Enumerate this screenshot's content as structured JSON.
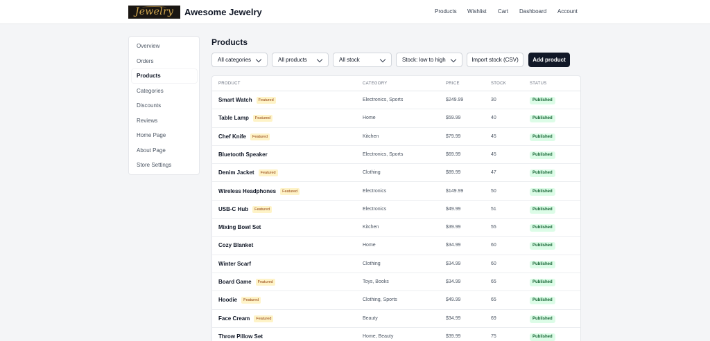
{
  "header": {
    "logo_text": "Jewelry",
    "brand": "Awesome Jewelry",
    "nav": [
      "Products",
      "Wishlist",
      "Cart",
      "Dashboard",
      "Account"
    ]
  },
  "sidebar": {
    "items": [
      {
        "label": "Overview"
      },
      {
        "label": "Orders"
      },
      {
        "label": "Products",
        "active": true
      },
      {
        "label": "Categories"
      },
      {
        "label": "Discounts"
      },
      {
        "label": "Reviews"
      },
      {
        "label": "Home Page"
      },
      {
        "label": "About Page"
      },
      {
        "label": "Store Settings"
      }
    ]
  },
  "main": {
    "title": "Products",
    "filters": {
      "category": "All categories",
      "products": "All products",
      "stock": "All stock",
      "sort": "Stock: low to high"
    },
    "import_label": "Import stock (CSV)",
    "add_label": "Add product",
    "columns": [
      "PRODUCT",
      "CATEGORY",
      "PRICE",
      "STOCK",
      "STATUS"
    ],
    "featured_label": "Featured",
    "rows": [
      {
        "name": "Smart Watch",
        "featured": true,
        "category": "Electronics, Sports",
        "price": "$249.99",
        "stock": "30",
        "status": "Published"
      },
      {
        "name": "Table Lamp",
        "featured": true,
        "category": "Home",
        "price": "$59.99",
        "stock": "40",
        "status": "Published"
      },
      {
        "name": "Chef Knife",
        "featured": true,
        "category": "Kitchen",
        "price": "$79.99",
        "stock": "45",
        "status": "Published"
      },
      {
        "name": "Bluetooth Speaker",
        "featured": false,
        "category": "Electronics, Sports",
        "price": "$69.99",
        "stock": "45",
        "status": "Published"
      },
      {
        "name": "Denim Jacket",
        "featured": true,
        "category": "Clothing",
        "price": "$89.99",
        "stock": "47",
        "status": "Published"
      },
      {
        "name": "Wireless Headphones",
        "featured": true,
        "category": "Electronics",
        "price": "$149.99",
        "stock": "50",
        "status": "Published"
      },
      {
        "name": "USB-C Hub",
        "featured": true,
        "category": "Electronics",
        "price": "$49.99",
        "stock": "51",
        "status": "Published"
      },
      {
        "name": "Mixing Bowl Set",
        "featured": false,
        "category": "Kitchen",
        "price": "$39.99",
        "stock": "55",
        "status": "Published"
      },
      {
        "name": "Cozy Blanket",
        "featured": false,
        "category": "Home",
        "price": "$34.99",
        "stock": "60",
        "status": "Published"
      },
      {
        "name": "Winter Scarf",
        "featured": false,
        "category": "Clothing",
        "price": "$34.99",
        "stock": "60",
        "status": "Published"
      },
      {
        "name": "Board Game",
        "featured": true,
        "category": "Toys, Books",
        "price": "$34.99",
        "stock": "65",
        "status": "Published"
      },
      {
        "name": "Hoodie",
        "featured": true,
        "category": "Clothing, Sports",
        "price": "$49.99",
        "stock": "65",
        "status": "Published"
      },
      {
        "name": "Face Cream",
        "featured": true,
        "category": "Beauty",
        "price": "$34.99",
        "stock": "69",
        "status": "Published"
      },
      {
        "name": "Throw Pillow Set",
        "featured": false,
        "category": "Home, Beauty",
        "price": "$39.99",
        "stock": "75",
        "status": "Published"
      }
    ]
  },
  "colors": {
    "accent_dark": "#111827",
    "published_bg": "#dcfce7",
    "published_text": "#166534",
    "featured_bg": "#fef3c7",
    "featured_text": "#92400e"
  },
  "icons": {
    "dropdown": "chevron-down-icon"
  }
}
